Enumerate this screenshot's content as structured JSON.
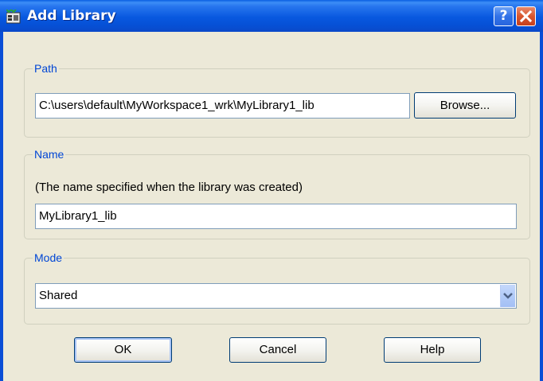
{
  "window": {
    "title": "Add Library",
    "help_glyph": "?"
  },
  "path": {
    "legend": "Path",
    "value": "C:\\users\\default\\MyWorkspace1_wrk\\MyLibrary1_lib",
    "browse_label": "Browse..."
  },
  "name": {
    "legend": "Name",
    "hint": "(The name specified when the library was created)",
    "value": "MyLibrary1_lib"
  },
  "mode": {
    "legend": "Mode",
    "selected": "Shared"
  },
  "buttons": {
    "ok": "OK",
    "cancel": "Cancel",
    "help": "Help"
  },
  "colors": {
    "accent": "#0046d5",
    "titlebar": "#0858df",
    "dialog_bg": "#ece9d8"
  }
}
